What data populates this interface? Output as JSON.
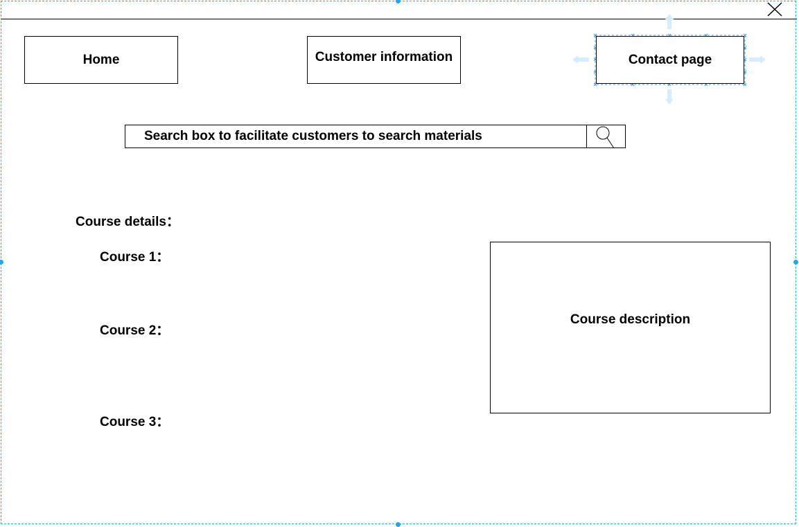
{
  "window": {
    "close_icon": "close-icon"
  },
  "nav": {
    "home_label": "Home",
    "customer_label": "Customer information",
    "contact_label": "Contact page"
  },
  "search": {
    "text": "Search box to facilitate customers to search materials",
    "icon": "search-icon"
  },
  "courses": {
    "heading": "Course details：",
    "items": [
      "Course 1：",
      "Course 2：",
      "Course 3："
    ],
    "description": "Course description"
  },
  "colors": {
    "selection": "#3aa0e8",
    "handle": "#29a3f0",
    "guide": "#d6ecfb",
    "stroke": "#000000"
  }
}
